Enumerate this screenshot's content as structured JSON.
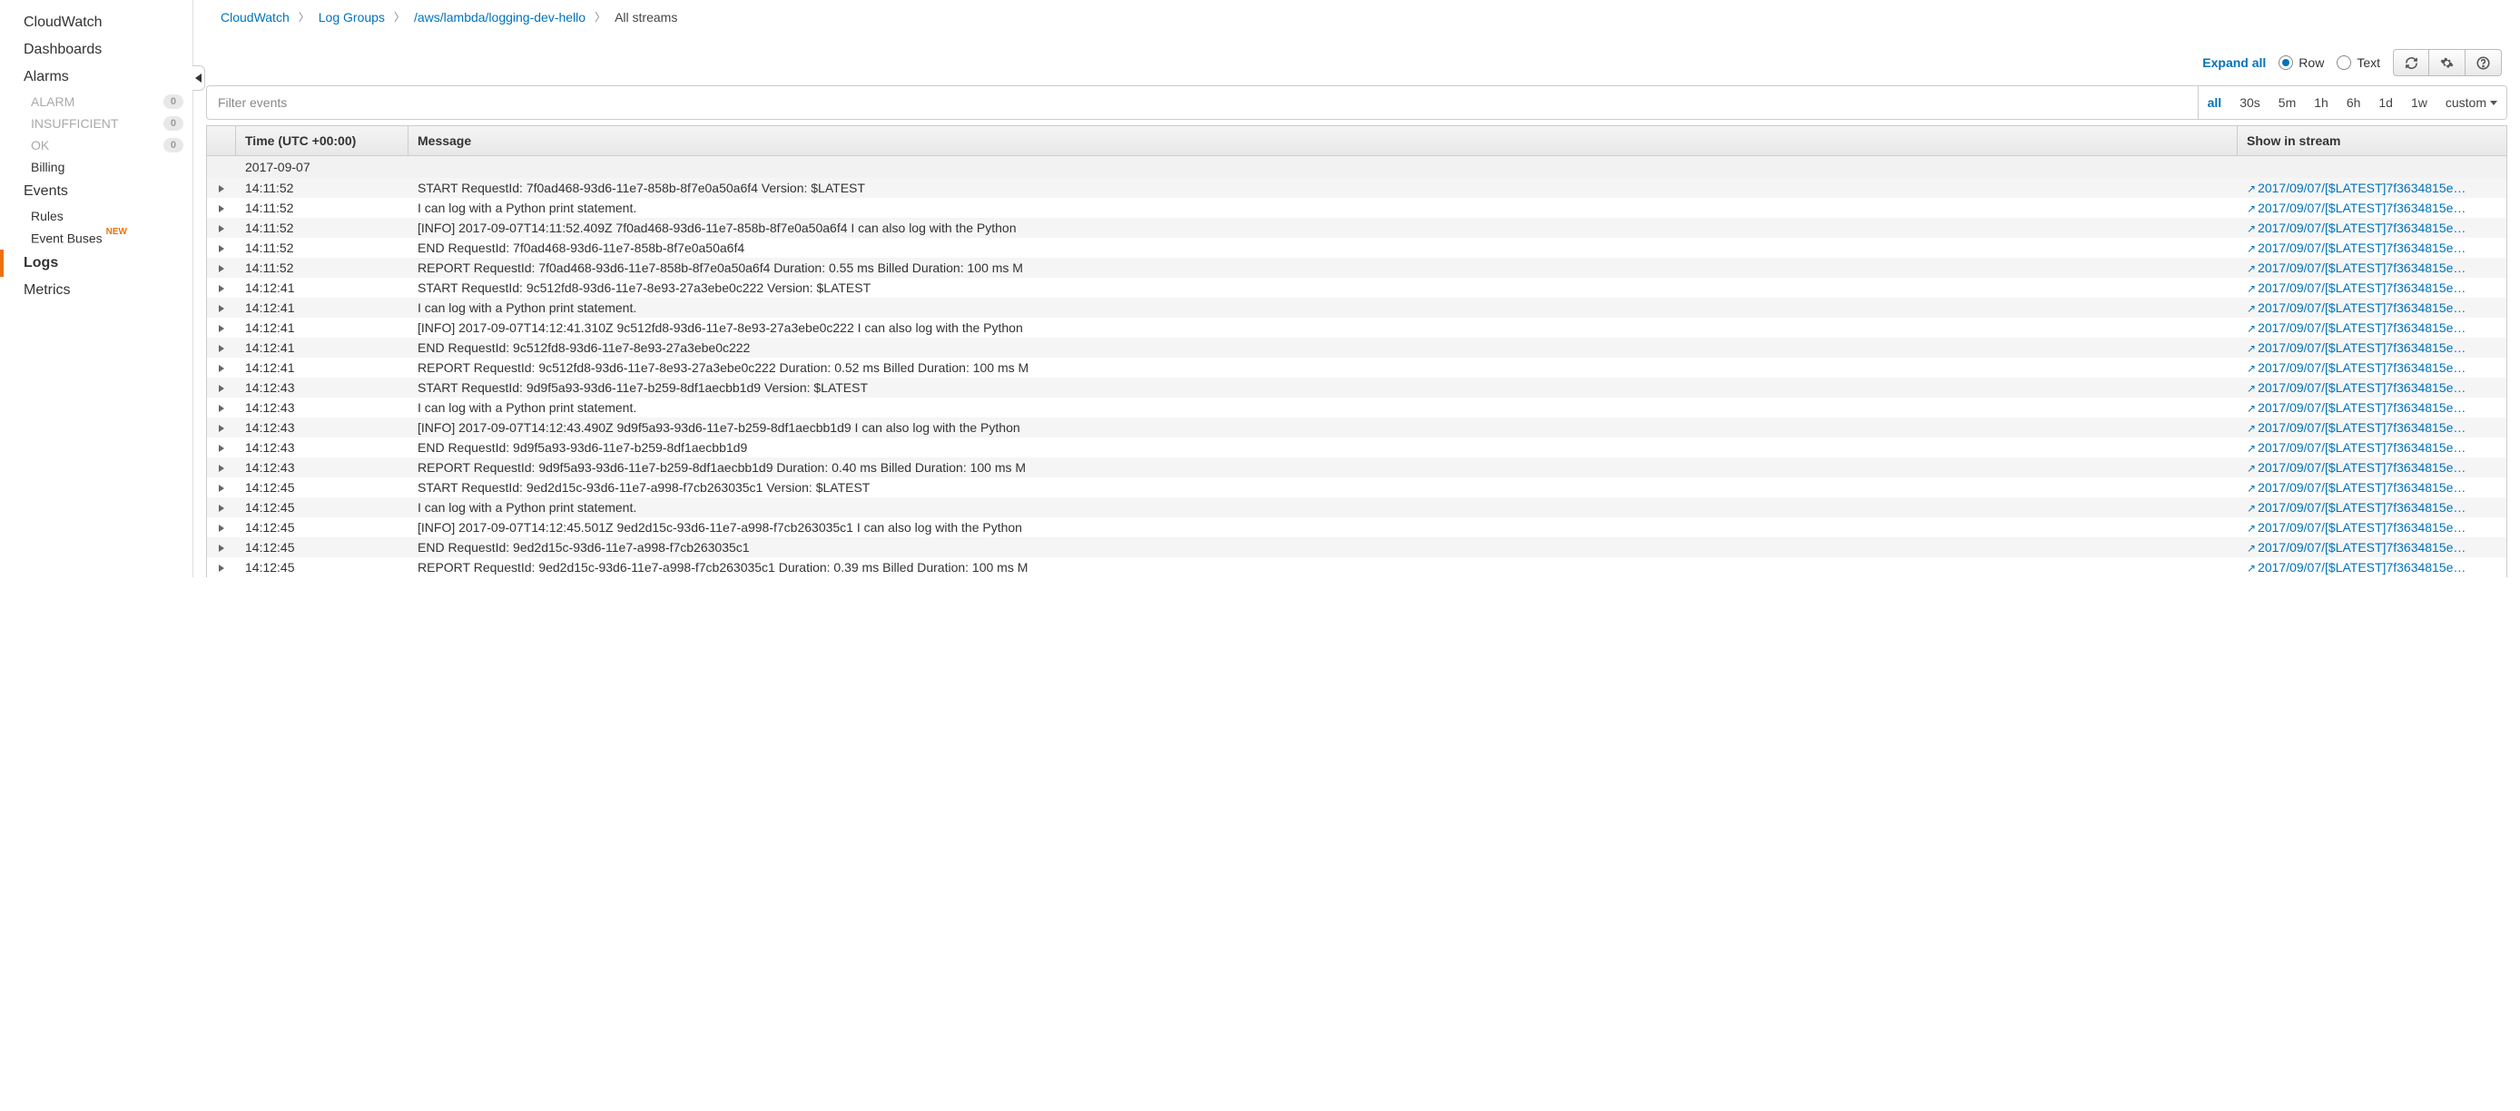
{
  "sidebar": {
    "items": [
      {
        "label": "CloudWatch",
        "type": "item"
      },
      {
        "label": "Dashboards",
        "type": "item"
      },
      {
        "label": "Alarms",
        "type": "item"
      },
      {
        "label": "ALARM",
        "type": "sub",
        "muted": true,
        "count": "0"
      },
      {
        "label": "INSUFFICIENT",
        "type": "sub",
        "muted": true,
        "count": "0"
      },
      {
        "label": "OK",
        "type": "sub",
        "muted": true,
        "count": "0"
      },
      {
        "label": "Billing",
        "type": "sub"
      },
      {
        "label": "Events",
        "type": "item"
      },
      {
        "label": "Rules",
        "type": "sub"
      },
      {
        "label": "Event Buses",
        "type": "sub",
        "newFlag": "NEW"
      },
      {
        "label": "Logs",
        "type": "item",
        "selected": true
      },
      {
        "label": "Metrics",
        "type": "item"
      }
    ]
  },
  "breadcrumbs": {
    "items": [
      {
        "label": "CloudWatch",
        "link": true
      },
      {
        "label": "Log Groups",
        "link": true
      },
      {
        "label": "/aws/lambda/logging-dev-hello",
        "link": true
      },
      {
        "label": "All streams",
        "link": false
      }
    ]
  },
  "toolbar": {
    "expand_all": "Expand all",
    "view_row": "Row",
    "view_text": "Text"
  },
  "filter": {
    "placeholder": "Filter events",
    "ranges": [
      "all",
      "30s",
      "5m",
      "1h",
      "6h",
      "1d",
      "1w",
      "custom"
    ],
    "active_range": "all"
  },
  "columns": {
    "time": "Time (UTC +00:00)",
    "message": "Message",
    "stream": "Show in stream"
  },
  "date_header": "2017-09-07",
  "stream_link_text": "2017/09/07/[$LATEST]7f3634815e…",
  "events": [
    {
      "time": "14:11:52",
      "message": "START RequestId: 7f0ad468-93d6-11e7-858b-8f7e0a50a6f4 Version: $LATEST"
    },
    {
      "time": "14:11:52",
      "message": "I can log with a Python print statement."
    },
    {
      "time": "14:11:52",
      "message": "[INFO] 2017-09-07T14:11:52.409Z 7f0ad468-93d6-11e7-858b-8f7e0a50a6f4 I can also log with the Python"
    },
    {
      "time": "14:11:52",
      "message": "END RequestId: 7f0ad468-93d6-11e7-858b-8f7e0a50a6f4"
    },
    {
      "time": "14:11:52",
      "message": "REPORT RequestId: 7f0ad468-93d6-11e7-858b-8f7e0a50a6f4 Duration: 0.55 ms Billed Duration: 100 ms M"
    },
    {
      "time": "14:12:41",
      "message": "START RequestId: 9c512fd8-93d6-11e7-8e93-27a3ebe0c222 Version: $LATEST"
    },
    {
      "time": "14:12:41",
      "message": "I can log with a Python print statement."
    },
    {
      "time": "14:12:41",
      "message": "[INFO] 2017-09-07T14:12:41.310Z 9c512fd8-93d6-11e7-8e93-27a3ebe0c222 I can also log with the Python"
    },
    {
      "time": "14:12:41",
      "message": "END RequestId: 9c512fd8-93d6-11e7-8e93-27a3ebe0c222"
    },
    {
      "time": "14:12:41",
      "message": "REPORT RequestId: 9c512fd8-93d6-11e7-8e93-27a3ebe0c222 Duration: 0.52 ms Billed Duration: 100 ms M"
    },
    {
      "time": "14:12:43",
      "message": "START RequestId: 9d9f5a93-93d6-11e7-b259-8df1aecbb1d9 Version: $LATEST"
    },
    {
      "time": "14:12:43",
      "message": "I can log with a Python print statement."
    },
    {
      "time": "14:12:43",
      "message": "[INFO] 2017-09-07T14:12:43.490Z 9d9f5a93-93d6-11e7-b259-8df1aecbb1d9 I can also log with the Python"
    },
    {
      "time": "14:12:43",
      "message": "END RequestId: 9d9f5a93-93d6-11e7-b259-8df1aecbb1d9"
    },
    {
      "time": "14:12:43",
      "message": "REPORT RequestId: 9d9f5a93-93d6-11e7-b259-8df1aecbb1d9 Duration: 0.40 ms Billed Duration: 100 ms M"
    },
    {
      "time": "14:12:45",
      "message": "START RequestId: 9ed2d15c-93d6-11e7-a998-f7cb263035c1 Version: $LATEST"
    },
    {
      "time": "14:12:45",
      "message": "I can log with a Python print statement."
    },
    {
      "time": "14:12:45",
      "message": "[INFO] 2017-09-07T14:12:45.501Z 9ed2d15c-93d6-11e7-a998-f7cb263035c1 I can also log with the Python"
    },
    {
      "time": "14:12:45",
      "message": "END RequestId: 9ed2d15c-93d6-11e7-a998-f7cb263035c1"
    },
    {
      "time": "14:12:45",
      "message": "REPORT RequestId: 9ed2d15c-93d6-11e7-a998-f7cb263035c1 Duration: 0.39 ms Billed Duration: 100 ms M"
    }
  ]
}
